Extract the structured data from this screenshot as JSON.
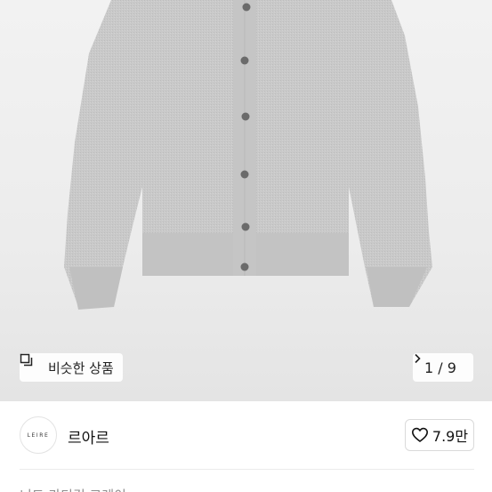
{
  "product": {
    "image_counter": "1 / 9",
    "similar_label": "비슷한 상품"
  },
  "seller": {
    "avatar_text": "LEIRE",
    "name": "르아르",
    "likes": "7.9만"
  },
  "footer": {
    "cutoff_text": "니트 가디건 그레이"
  },
  "icons": {
    "similar": "similar-items-icon",
    "next": "chevron-right-icon",
    "like": "heart-outline-icon"
  }
}
